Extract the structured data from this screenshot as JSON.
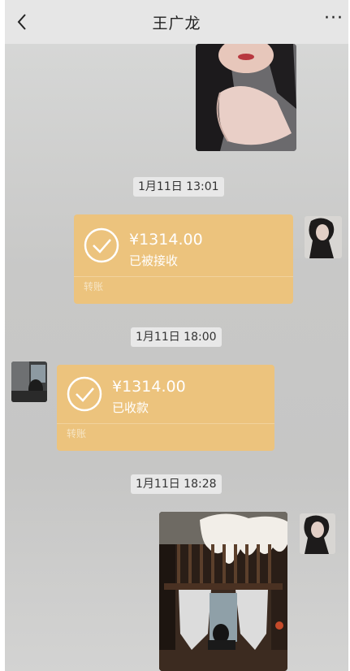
{
  "header": {
    "title": "王广龙",
    "more_label": "···"
  },
  "messages": {
    "time1": "1月11日 13:01",
    "transfer1": {
      "amount": "¥1314.00",
      "status": "已被接收",
      "tag": "转账"
    },
    "time2": "1月11日 18:00",
    "transfer2": {
      "amount": "¥1314.00",
      "status": "已收款",
      "tag": "转账"
    },
    "time3": "1月11日 18:28"
  },
  "colors": {
    "transfer_bubble": "#ecc37d",
    "chat_bg": "#c8c8c7",
    "topbar": "#e6e6e6"
  },
  "icons": [
    "back-arrow-icon",
    "check-circle-icon"
  ]
}
